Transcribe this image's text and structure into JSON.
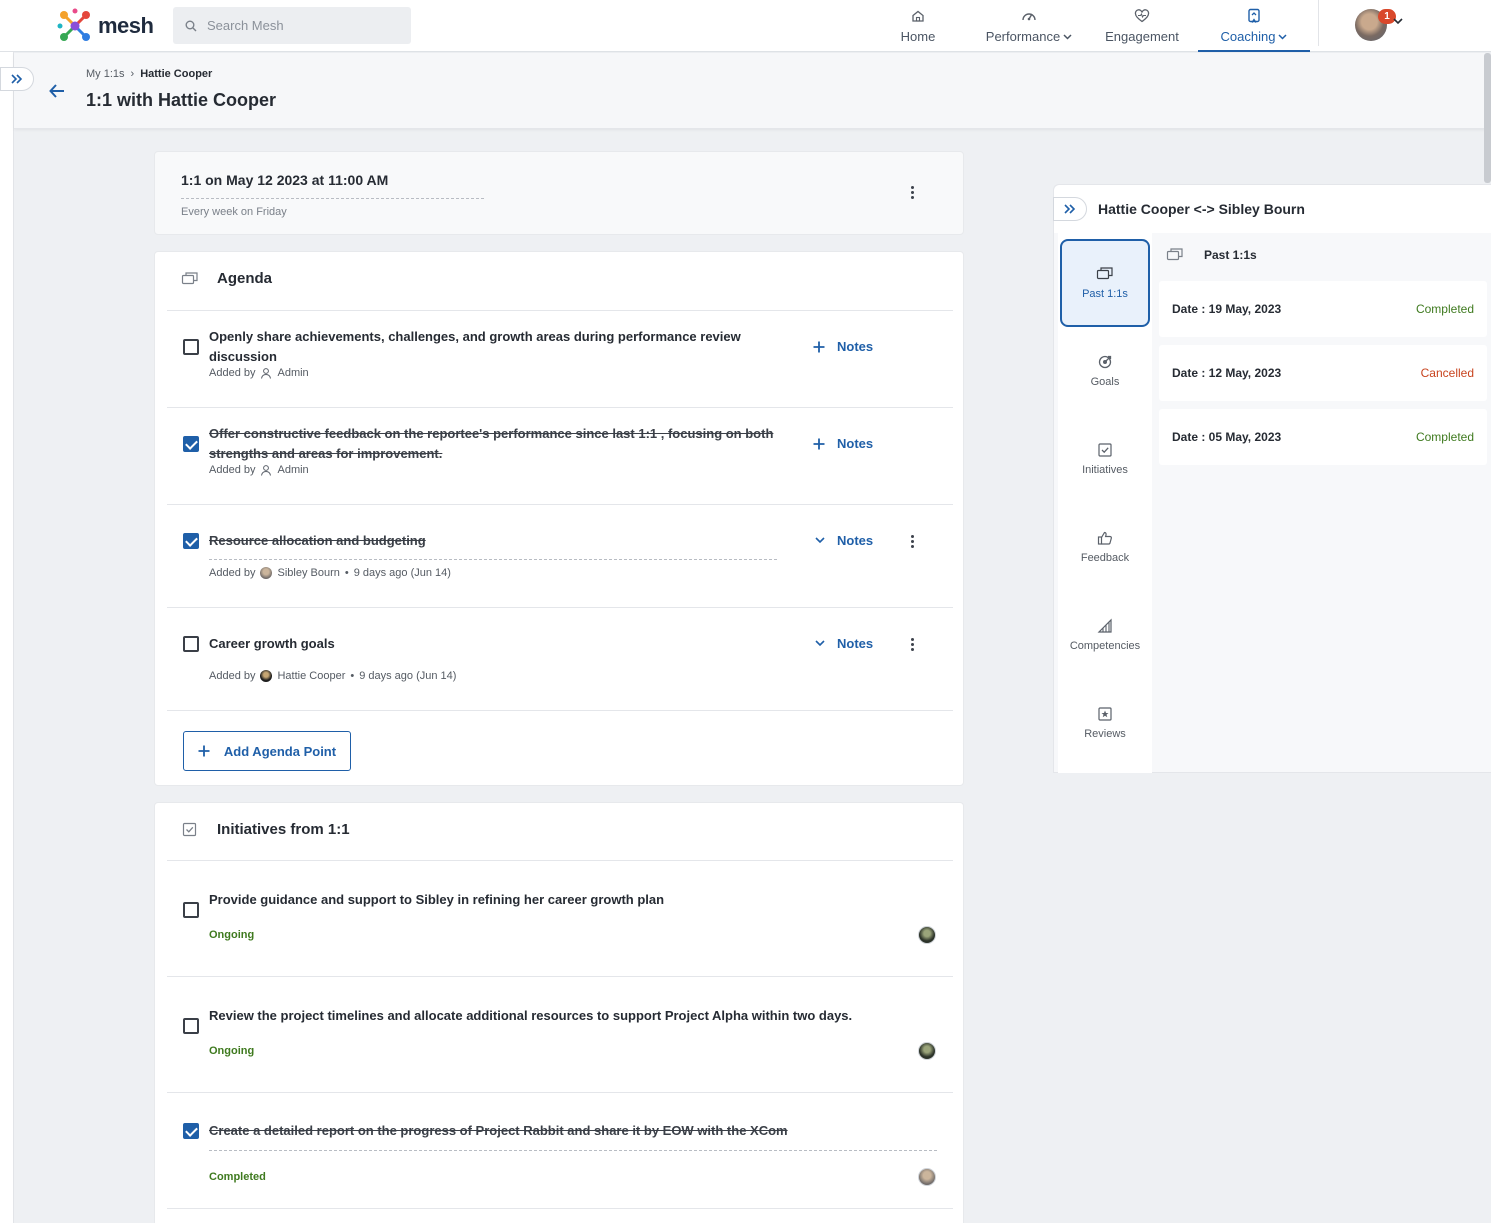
{
  "app": {
    "name": "mesh"
  },
  "search": {
    "placeholder": "Search Mesh"
  },
  "nav": {
    "items": [
      {
        "label": "Home",
        "icon": "home-icon"
      },
      {
        "label": "Performance",
        "icon": "performance-icon"
      },
      {
        "label": "Engagement",
        "icon": "engagement-icon"
      },
      {
        "label": "Coaching",
        "icon": "coaching-icon",
        "active": true
      }
    ],
    "notification_count": "1"
  },
  "breadcrumb": {
    "parent": "My 1:1s",
    "separator": "›",
    "current": "Hattie Cooper"
  },
  "page": {
    "title": "1:1 with Hattie Cooper"
  },
  "meeting": {
    "title": "1:1 on May 12 2023 at 11:00 AM",
    "recurrence": "Every week on Friday"
  },
  "agenda": {
    "title": "Agenda",
    "notes_label": "Notes",
    "added_by_label": "Added by",
    "items": [
      {
        "text_line1": "Openly share achievements, challenges, and growth areas during performance review",
        "text_line2": "discussion",
        "added_by": "Admin",
        "checked": false
      },
      {
        "text_line1": "Offer constructive feedback on the reportee's performance since last 1:1 , focusing on both",
        "text_line2": "strengths and areas for improvement.",
        "added_by": "Admin",
        "checked": true
      },
      {
        "text_line1": "Resource allocation and budgeting",
        "added_by": "Sibley Bourn",
        "when": "9 days ago (Jun 14)",
        "checked": true
      },
      {
        "text_line1": "Career growth goals",
        "added_by": "Hattie Cooper",
        "when": "9 days ago (Jun 14)",
        "checked": false
      }
    ],
    "add_label": "Add Agenda Point"
  },
  "initiatives": {
    "title": "Initiatives from 1:1",
    "items": [
      {
        "text": "Provide guidance and support to Sibley in refining her career growth plan",
        "status": "Ongoing",
        "checked": false
      },
      {
        "text": "Review the project timelines and allocate additional resources to support Project Alpha within two days.",
        "status": "Ongoing",
        "checked": false
      },
      {
        "text": "Create a detailed report on the progress of Project Rabbit and share it by EOW with the XCom",
        "status": "Completed",
        "checked": true
      }
    ]
  },
  "side_panel": {
    "title": "Hattie Cooper <-> Sibley Bourn",
    "tabs": [
      {
        "label": "Past 1:1s",
        "icon": "chat-icon",
        "active": true
      },
      {
        "label": "Goals",
        "icon": "target-icon"
      },
      {
        "label": "Initiatives",
        "icon": "checkbox-icon"
      },
      {
        "label": "Feedback",
        "icon": "thumbs-up-icon"
      },
      {
        "label": "Competencies",
        "icon": "competencies-icon"
      },
      {
        "label": "Reviews",
        "icon": "star-icon"
      }
    ],
    "content_title": "Past 1:1s",
    "past": [
      {
        "date": "Date : 19 May, 2023",
        "status": "Completed"
      },
      {
        "date": "Date : 12 May, 2023",
        "status": "Cancelled"
      },
      {
        "date": "Date : 05 May, 2023",
        "status": "Completed"
      }
    ]
  },
  "colors": {
    "accent": "#1f5fa8",
    "ongoing": "#3f7a1f",
    "cancelled": "#c8441f",
    "badge": "#d9482b"
  }
}
